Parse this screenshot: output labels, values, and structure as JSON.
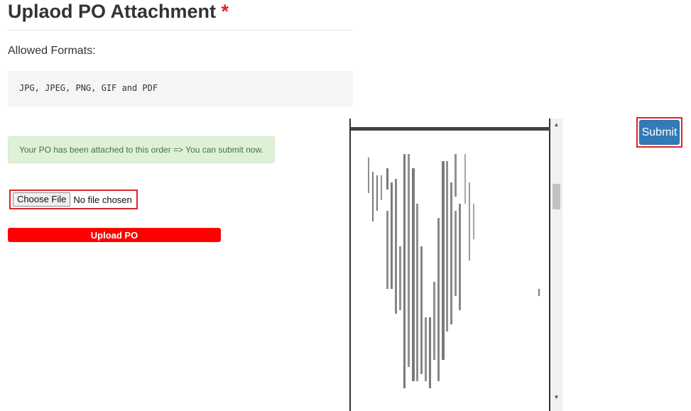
{
  "page": {
    "title": "Uplaod PO Attachment",
    "required_mark": "*"
  },
  "formats": {
    "label": "Allowed Formats:",
    "list": "JPG, JPEG, PNG, GIF and PDF"
  },
  "alert": {
    "message": "Your PO has been attached to this order => You can submit now."
  },
  "file_input": {
    "button_label": "Choose File",
    "status": "No file chosen"
  },
  "upload": {
    "button_label": "Upload PO"
  },
  "submit": {
    "button_label": "Submit"
  },
  "preview": {
    "scroll_up": "▲",
    "scroll_down": "▼"
  },
  "colors": {
    "required": "#e02020",
    "alert_bg": "#dff0d8",
    "alert_text": "#3c763d",
    "upload_bg": "#ff0000",
    "submit_bg": "#337ab7",
    "highlight_border": "#d9262e"
  }
}
